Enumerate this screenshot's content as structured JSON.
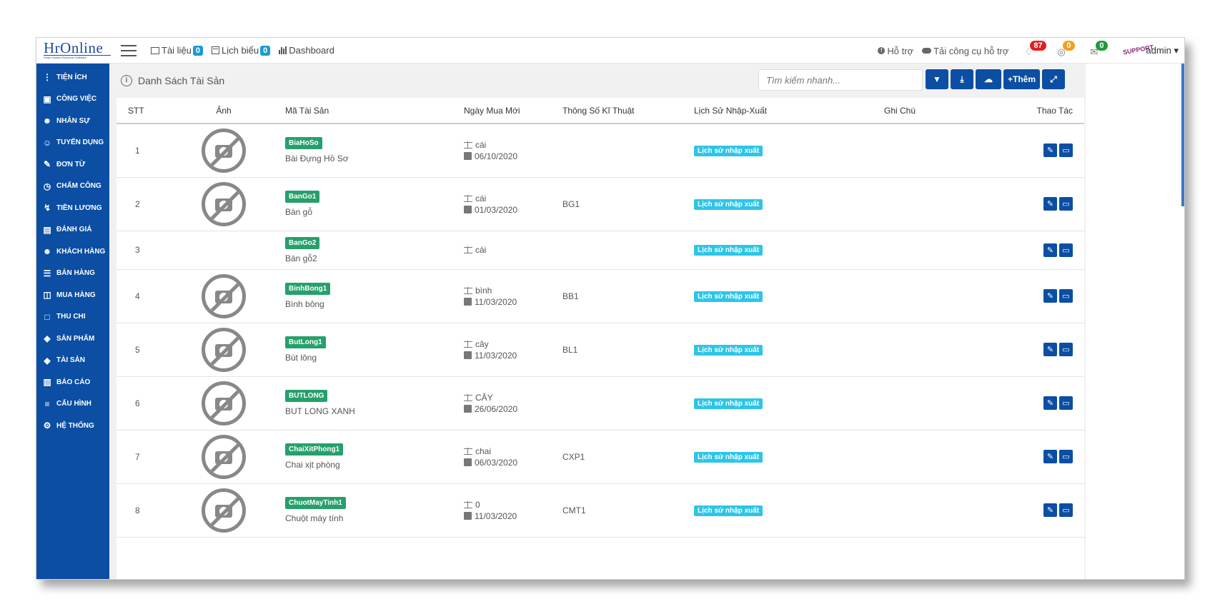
{
  "app": {
    "logo": "HrOnline",
    "logo_sub": "Smart Human Resource Software"
  },
  "topnav": {
    "docs_label": "Tài liệu",
    "docs_count": "0",
    "forms_label": "Lịch biểu",
    "forms_count": "0",
    "dashboard_label": "Dashboard",
    "support_label": "Hỗ trợ",
    "download_label": "Tải công cụ hỗ trợ",
    "notif_red": "87",
    "notif_orange": "0",
    "notif_green": "0",
    "avatar_text": "SUPPORT",
    "user": "admin"
  },
  "sidebar": {
    "items": [
      {
        "label": "TIỆN ÍCH",
        "icon": "more-vert-icon"
      },
      {
        "label": "CÔNG VIỆC",
        "icon": "inbox-icon"
      },
      {
        "label": "NHÂN SỰ",
        "icon": "user-icon"
      },
      {
        "label": "TUYỂN DỤNG",
        "icon": "user-plus-icon"
      },
      {
        "label": "ĐƠN TỪ",
        "icon": "edit-icon"
      },
      {
        "label": "CHẤM CÔNG",
        "icon": "gauge-icon"
      },
      {
        "label": "TIỀN LƯƠNG",
        "icon": "bolt-icon"
      },
      {
        "label": "ĐÁNH GIÁ",
        "icon": "book-icon"
      },
      {
        "label": "KHÁCH HÀNG",
        "icon": "customer-icon"
      },
      {
        "label": "BÁN HÀNG",
        "icon": "list-icon"
      },
      {
        "label": "MUA HÀNG",
        "icon": "columns-icon"
      },
      {
        "label": "THU CHI",
        "icon": "file-icon"
      },
      {
        "label": "SẢN PHẨM",
        "icon": "tag-icon"
      },
      {
        "label": "TÀI SẢN",
        "icon": "diamond-icon"
      },
      {
        "label": "BÁO CÁO",
        "icon": "chart-icon"
      },
      {
        "label": "CẤU HÌNH",
        "icon": "layers-icon"
      },
      {
        "label": "HỆ THỐNG",
        "icon": "gear-icon"
      }
    ]
  },
  "panel": {
    "title": "Danh Sách Tài Sản",
    "search_placeholder": "Tìm kiếm nhanh...",
    "add_label": "Thêm"
  },
  "table": {
    "headers": [
      "STT",
      "Ảnh",
      "Mã Tài Sản",
      "Ngày Mua Mới",
      "Thông Số Kĩ Thuật",
      "Lịch Sử Nhập-Xuất",
      "Ghi Chú",
      "Thao Tác"
    ],
    "history_label": "Lịch sử nhập xuất",
    "rows": [
      {
        "stt": "1",
        "has_img": true,
        "code": "BiaHoSo",
        "name": "Bài Đựng Hồ Sơ",
        "unit": "cái",
        "date": "06/10/2020",
        "spec": ""
      },
      {
        "stt": "2",
        "has_img": true,
        "code": "BanGo1",
        "name": "Bàn gỗ",
        "unit": "cái",
        "date": "01/03/2020",
        "spec": "BG1"
      },
      {
        "stt": "3",
        "has_img": false,
        "code": "BanGo2",
        "name": "Bàn gỗ2",
        "unit": "cái",
        "date": "",
        "spec": ""
      },
      {
        "stt": "4",
        "has_img": true,
        "code": "BinhBong1",
        "name": "Bình bông",
        "unit": "bình",
        "date": "11/03/2020",
        "spec": "BB1"
      },
      {
        "stt": "5",
        "has_img": true,
        "code": "ButLong1",
        "name": "Bút lông",
        "unit": "cây",
        "date": "11/03/2020",
        "spec": "BL1"
      },
      {
        "stt": "6",
        "has_img": true,
        "code": "BUTLONG",
        "name": "BUT LONG XANH",
        "unit": "CÂY",
        "date": "26/06/2020",
        "spec": ""
      },
      {
        "stt": "7",
        "has_img": true,
        "code": "ChaiXitPhong1",
        "name": "Chai xịt phòng",
        "unit": "chai",
        "date": "06/03/2020",
        "spec": "CXP1"
      },
      {
        "stt": "8",
        "has_img": true,
        "code": "ChuotMayTinh1",
        "name": "Chuột máy tính",
        "unit": "0",
        "date": "11/03/2020",
        "spec": "CMT1"
      }
    ]
  },
  "colors": {
    "primary": "#0b4ea3",
    "tag_green": "#26a06b",
    "history_cyan": "#2cc5e8",
    "badge_red": "#e02020",
    "badge_orange": "#f0a020",
    "badge_green": "#1f9a3c"
  }
}
